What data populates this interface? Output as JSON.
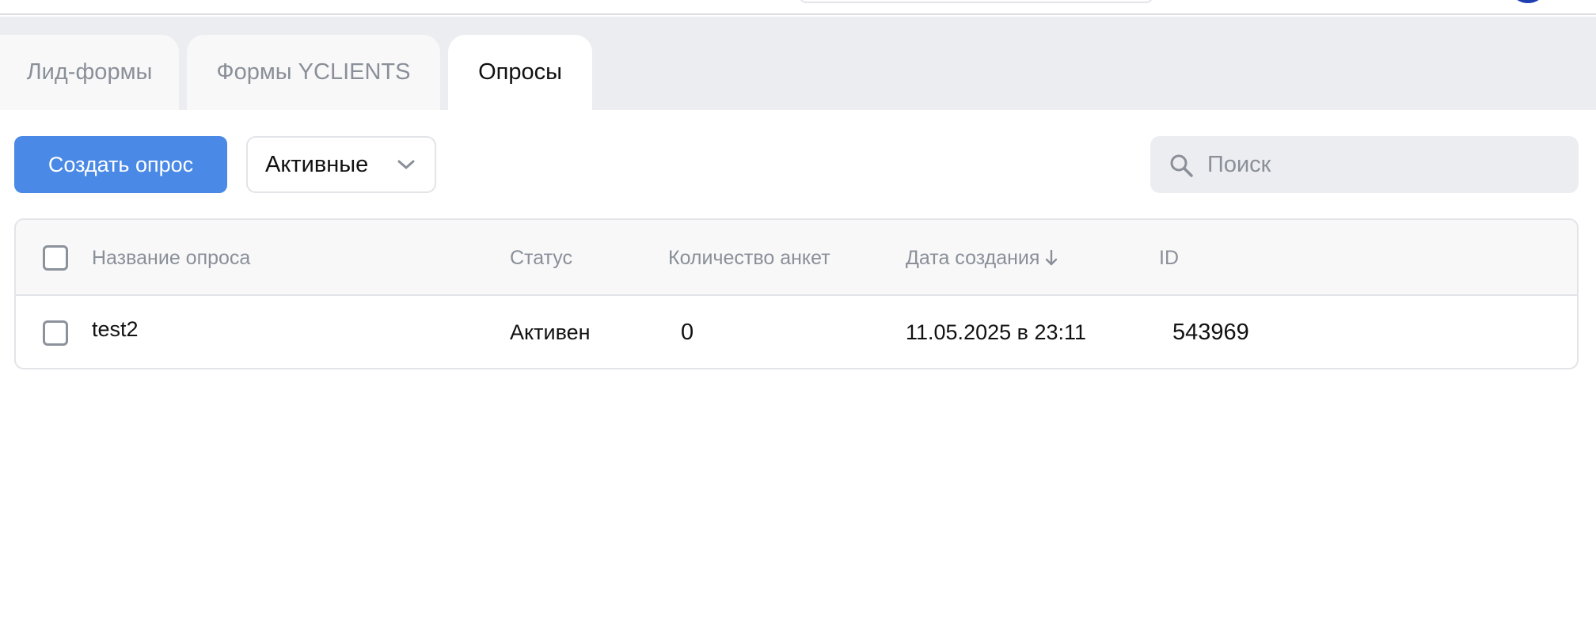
{
  "tabs": [
    {
      "label": "Лид-формы",
      "active": false
    },
    {
      "label": "Формы YCLIENTS",
      "active": false
    },
    {
      "label": "Опросы",
      "active": true
    }
  ],
  "toolbar": {
    "create_label": "Создать опрос",
    "filter_value": "Активные",
    "search_placeholder": "Поиск"
  },
  "table": {
    "columns": {
      "name": "Название опроса",
      "status": "Статус",
      "count": "Количество анкет",
      "date": "Дата создания",
      "id": "ID"
    },
    "sort_indicator": "down-arrow-icon",
    "rows": [
      {
        "name": "test2",
        "status": "Активен",
        "count": "0",
        "date": "11.05.2025 в 23:11",
        "id": "543969"
      }
    ]
  },
  "colors": {
    "accent": "#4a89e5",
    "tab_bar_bg": "#ecedf1",
    "muted_text": "#8a8f98",
    "border": "#e3e4e8"
  }
}
